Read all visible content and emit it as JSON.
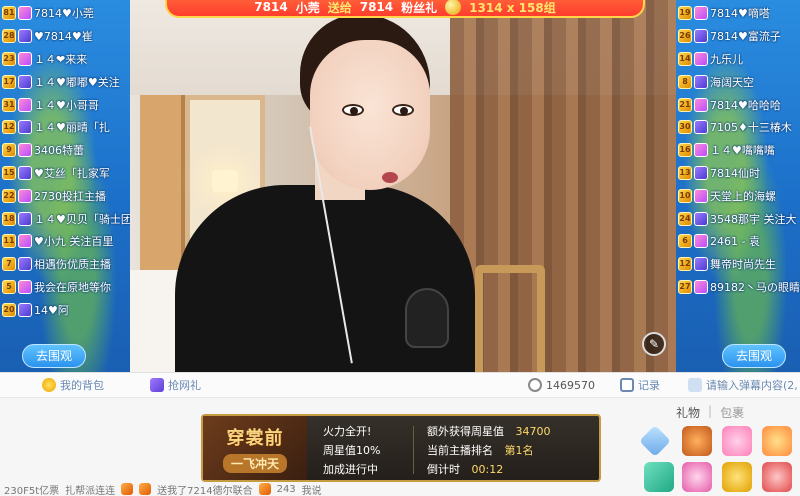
{
  "top_banner": {
    "prefix": "7814",
    "name": "小莞",
    "action": "送给",
    "target": "7814",
    "gift": "粉丝礼",
    "count": "1314 x 158组"
  },
  "left_chat": {
    "lines": [
      {
        "lvl": "81",
        "text": "7814♥小莞"
      },
      {
        "lvl": "28",
        "text": "♥7814♥崔"
      },
      {
        "lvl": "23",
        "text": "１４❤来来"
      },
      {
        "lvl": "17",
        "text": "１４♥嘟嘟♥关注"
      },
      {
        "lvl": "31",
        "text": "１４♥小哥哥"
      },
      {
        "lvl": "12",
        "text": "１４♥丽晴「扎"
      },
      {
        "lvl": "9",
        "text": "3406特蕾"
      },
      {
        "lvl": "15",
        "text": "♥艾丝「扎家军"
      },
      {
        "lvl": "22",
        "text": "2730投扛主播"
      },
      {
        "lvl": "18",
        "text": "１４♥贝贝「骑士团"
      },
      {
        "lvl": "11",
        "text": "♥小九 关注百里"
      },
      {
        "lvl": "7",
        "text": "相遇伤优质主播"
      },
      {
        "lvl": "5",
        "text": "我会在原地等你"
      },
      {
        "lvl": "20",
        "text": "14♥阿"
      }
    ],
    "button": "去围观"
  },
  "right_chat": {
    "lines": [
      {
        "lvl": "19",
        "text": "7814♥嘀嗒"
      },
      {
        "lvl": "26",
        "text": "7814♥富流子"
      },
      {
        "lvl": "14",
        "text": "九乐儿"
      },
      {
        "lvl": "8",
        "text": "海阔天空"
      },
      {
        "lvl": "21",
        "text": "7814♥哈哈哈"
      },
      {
        "lvl": "30",
        "text": "7105♦十三椿木"
      },
      {
        "lvl": "16",
        "text": "１４♥嘴嘴嘴"
      },
      {
        "lvl": "13",
        "text": "7814仙时"
      },
      {
        "lvl": "10",
        "text": "天堂上的海螺"
      },
      {
        "lvl": "24",
        "text": "3548那宇 关注大"
      },
      {
        "lvl": "6",
        "text": "2461 - 袁"
      },
      {
        "lvl": "12",
        "text": "舞帝时尚先生"
      },
      {
        "lvl": "27",
        "text": "89182丶马の眼睛"
      }
    ],
    "button": "去围观"
  },
  "video": {
    "corner_icon": "edit-icon"
  },
  "toolbar": {
    "my_gifts": "我的背包",
    "grab_gift": "抢网礼",
    "viewers": "1469570",
    "record": "记录",
    "gift_hint": "请输入弹幕内容(2,"
  },
  "activity": {
    "logo_top": "穿裳前",
    "logo_bottom": "一飞冲天",
    "fire_power": "火力全开!",
    "star_value": "周星值10%",
    "in_progress": "加成进行中",
    "extra_label": "额外获得周星值",
    "extra_value": "34700",
    "rank_label": "当前主播排名",
    "rank_value": "第1名",
    "countdown_label": "倒计时",
    "countdown_value": "00:12"
  },
  "gift_panel": {
    "tab_gift": "礼物",
    "tab_bag": "包裹"
  },
  "bottom_chat": {
    "text1": "230F5t亿票",
    "text2": "扎帮派连连",
    "text3": "送我了7214德尔联合",
    "text4": "243",
    "text5": "我说"
  }
}
